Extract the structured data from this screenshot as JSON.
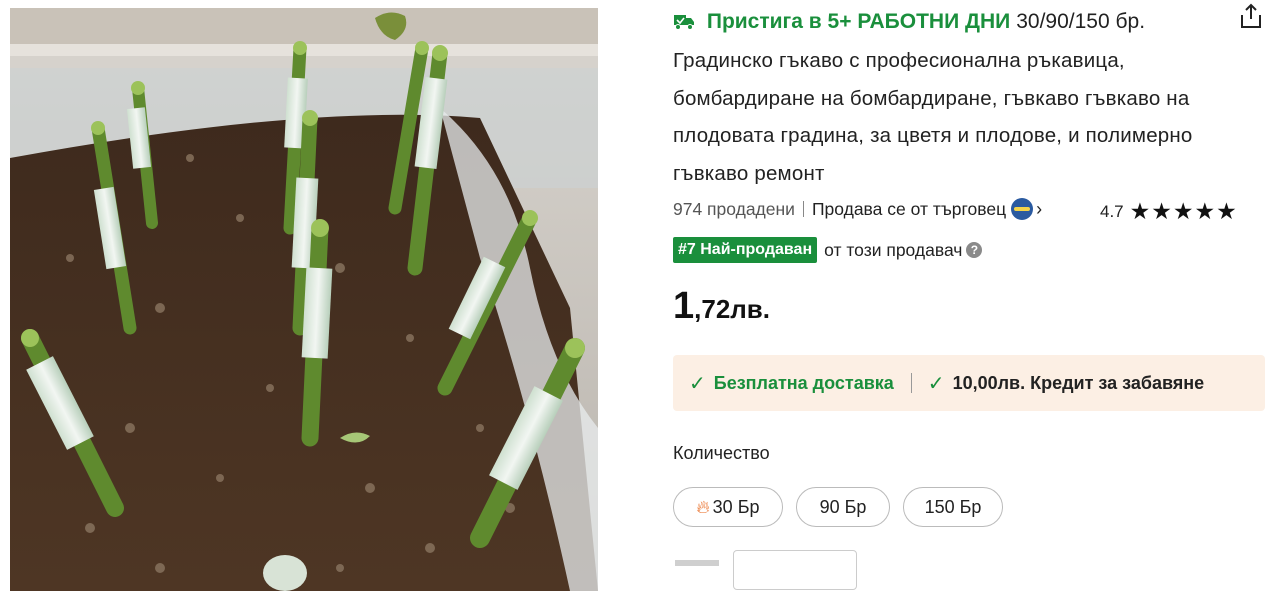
{
  "shipping": {
    "label": "Пристига в 5+ РАБОТНИ ДНИ",
    "variants": "30/90/150 бр."
  },
  "product": {
    "title": "Градинско гъкаво с професионална ръкавица, бомбардиране на бомбардиране, гъвкаво гъвкаво на плодовата градина, за цветя и плодове, и полимерно гъвкаво ремонт"
  },
  "meta": {
    "sold": "974 продадени",
    "seller": "Продава се от търговец"
  },
  "rating": {
    "value": "4.7",
    "stars": "★★★★★",
    "score": 4.7
  },
  "rank": {
    "badge": "#7 Най-продаван",
    "text": "от този продавач"
  },
  "price": {
    "integer": "1",
    "rest": ",72лв."
  },
  "benefits": {
    "free_shipping": "Безплатна доставка",
    "credit": "10,00лв. Кредит за забавяне"
  },
  "quantity": {
    "label": "Количество",
    "options": [
      "30 Бр",
      "90 Бр",
      "150 Бр"
    ]
  },
  "icons": {
    "truck": "truck-icon",
    "share": "share-icon",
    "check": "check-icon",
    "fire": "fire-icon",
    "help": "help-icon",
    "seller_badge": "seller-badge-icon",
    "chevron": "chevron-right-icon"
  },
  "colors": {
    "accent_green": "#1a8f3c",
    "benefits_bg": "#fcefe4",
    "fire": "#e8651a"
  }
}
